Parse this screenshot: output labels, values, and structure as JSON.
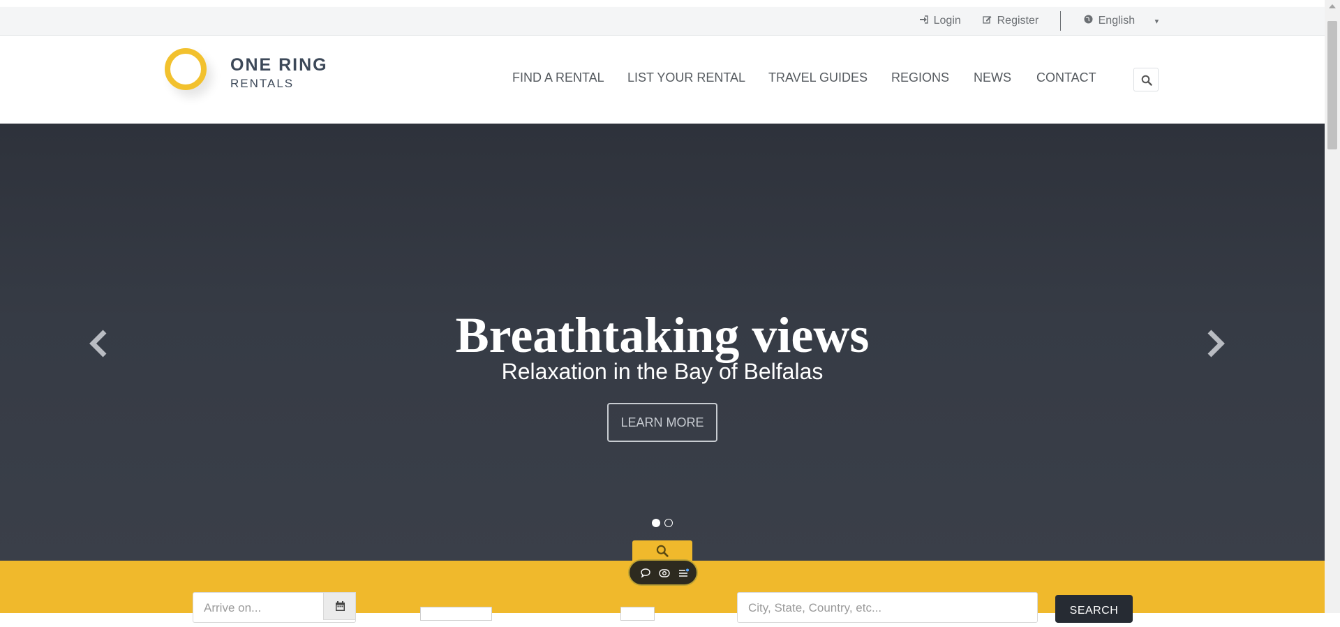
{
  "topbar": {
    "login_label": "Login",
    "register_label": "Register",
    "language_label": "English",
    "language_caret": "▾"
  },
  "brand": {
    "name_line1": "ONE RING",
    "name_line2": "RENTALS",
    "ring_color": "#f2c12e",
    "text_color": "#3c4858"
  },
  "nav": {
    "items": [
      {
        "label": "FIND A RENTAL"
      },
      {
        "label": "LIST YOUR RENTAL"
      },
      {
        "label": "TRAVEL GUIDES"
      },
      {
        "label": "REGIONS"
      },
      {
        "label": "NEWS"
      },
      {
        "label": "CONTACT"
      }
    ],
    "search_icon": "search-icon"
  },
  "hero": {
    "title": "Breathtaking views",
    "subtitle": "Relaxation in the Bay of Belfalas",
    "cta_label": "LEARN MORE",
    "slide_count": 2,
    "active_slide": 1,
    "background_color": "#363b45"
  },
  "search": {
    "arrive_placeholder": "Arrive on...",
    "location_placeholder": "City, State, Country, etc...",
    "submit_label": "SEARCH",
    "bar_color": "#f0b92c"
  },
  "floating_tools": {
    "icons": [
      "chat-icon",
      "eye-icon",
      "list-icon"
    ]
  },
  "colors": {
    "accent": "#f0b92c",
    "dark": "#262b33"
  }
}
